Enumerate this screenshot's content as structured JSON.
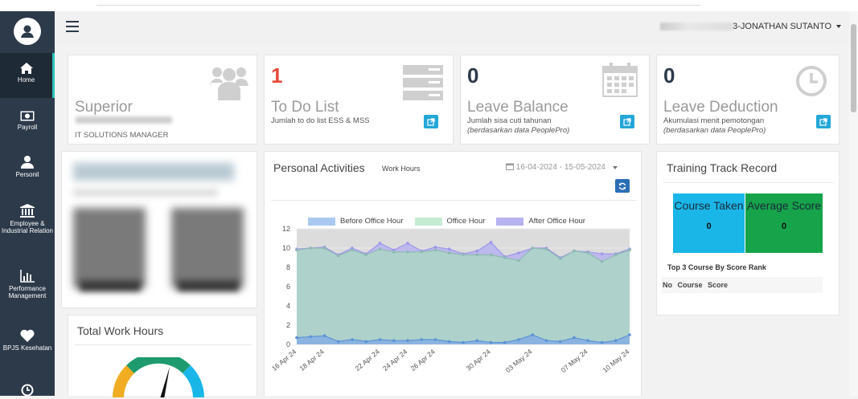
{
  "header": {
    "user_name": "3-JONATHAN SUTANTO"
  },
  "sidebar": {
    "items": [
      {
        "label": "Home",
        "icon": "home-icon"
      },
      {
        "label": "Payroll",
        "icon": "money-icon"
      },
      {
        "label": "Personil",
        "icon": "user-icon"
      },
      {
        "label": "Employee & Industrial Relation",
        "icon": "bank-icon"
      },
      {
        "label": "Performance Management",
        "icon": "bar-chart-icon"
      },
      {
        "label": "BPJS Kesehatan",
        "icon": "heart-icon"
      }
    ]
  },
  "cards": {
    "superior": {
      "title": "Superior",
      "position": "IT SOLUTIONS MANAGER"
    },
    "todo": {
      "count": "1",
      "title": "To Do List",
      "description": "Jumlah to do list ESS & MSS"
    },
    "leave_balance": {
      "count": "0",
      "title": "Leave Balance",
      "description": "Jumlah sisa cuti tahunan",
      "note": "(berdasarkan data PeoplePro)"
    },
    "leave_deduction": {
      "count": "0",
      "title": "Leave Deduction",
      "description": "Akumulasi menit pemotongan",
      "note": "(berdasarkan data PeoplePro)"
    }
  },
  "total_work_hours": {
    "title": "Total Work Hours"
  },
  "personal_activities": {
    "title": "Personal Activities",
    "subtitle": "Work Hours",
    "date_range": "16-04-2024 - 15-05-2024"
  },
  "training": {
    "title": "Training Track Record",
    "course_taken_label": "Course Taken",
    "course_taken_value": "0",
    "average_score_label": "Average Score",
    "average_score_value": "0",
    "top3_label": "Top 3 Course By Score Rank",
    "columns": [
      "No",
      "Course",
      "Score"
    ]
  },
  "colors": {
    "sidebar": "#2c3a4a",
    "todo_count": "#e74c3c",
    "accent": "#22a7d8",
    "course_taken": "#1ab6e8",
    "average_score": "#16a34a"
  },
  "chart_data": {
    "type": "area",
    "title": "",
    "xlabel": "",
    "ylabel": "",
    "ylim": [
      0,
      12
    ],
    "yticks": [
      0,
      2,
      4,
      6,
      8,
      10,
      12
    ],
    "x": [
      "16 Apr 24",
      "17 Apr 24",
      "18 Apr 24",
      "19 Apr 24",
      "20 Apr 24",
      "21 Apr 24",
      "22 Apr 24",
      "23 Apr 24",
      "24 Apr 24",
      "25 Apr 24",
      "26 Apr 24",
      "27 Apr 24",
      "28 Apr 24",
      "29 Apr 24",
      "30 Apr 24",
      "01 May 24",
      "02 May 24",
      "03 May 24",
      "04 May 24",
      "05 May 24",
      "06 May 24",
      "07 May 24",
      "08 May 24",
      "09 May 24",
      "10 May 24"
    ],
    "xtick_labels": [
      "16 Apr 24",
      "18 Apr 24",
      "22 Apr 24",
      "24 Apr 24",
      "26 Apr 24",
      "30 Apr 24",
      "03 May 24",
      "07 May 24",
      "10 May 24"
    ],
    "series": [
      {
        "name": "Before Office Hour",
        "color": "#a9c9f0",
        "values": [
          0.7,
          0.8,
          0.9,
          0.3,
          0.5,
          0.3,
          0.5,
          0.4,
          0.4,
          0.5,
          0.5,
          0.3,
          0.2,
          0.4,
          0.2,
          0.2,
          0.5,
          1.0,
          0.4,
          0.3,
          0.7,
          0.4,
          0.2,
          0.4,
          1.0
        ]
      },
      {
        "name": "Office Hour",
        "color": "#c5ebd2",
        "values": [
          9.1,
          9.2,
          9.1,
          8.9,
          9.3,
          9.0,
          9.4,
          9.2,
          9.2,
          9.1,
          9.3,
          9.2,
          9.1,
          8.9,
          9.1,
          8.8,
          8.2,
          9.0,
          9.5,
          8.6,
          9.0,
          9.1,
          8.4,
          8.9,
          8.8
        ]
      },
      {
        "name": "After Office Hour",
        "color": "#b7b3f0",
        "values": [
          0.1,
          0.0,
          0.1,
          0.1,
          0.2,
          0.1,
          0.6,
          0.2,
          0.9,
          0.1,
          0.3,
          0.4,
          0.1,
          0.4,
          1.3,
          0.1,
          0.8,
          0.0,
          0.1,
          0.1,
          0.0,
          0.1,
          0.8,
          0.1,
          0.1
        ]
      }
    ]
  }
}
